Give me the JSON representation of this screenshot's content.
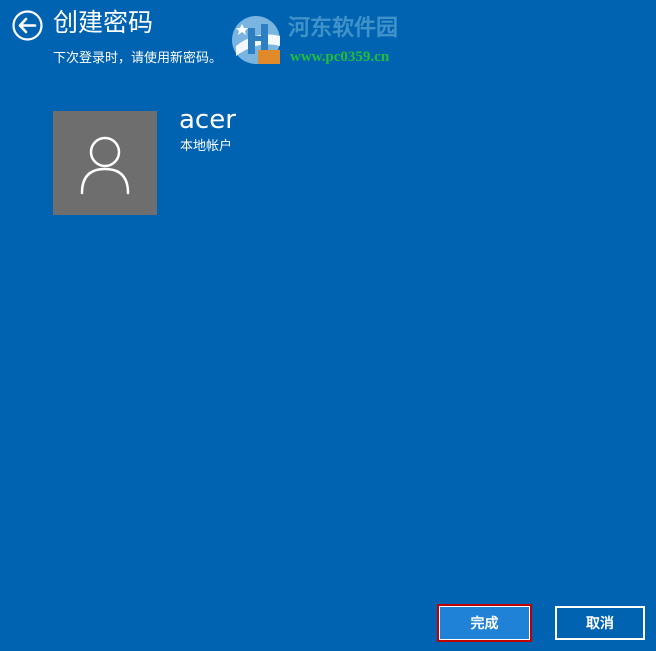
{
  "header": {
    "title": "创建密码",
    "subtitle": "下次登录时，请使用新密码。",
    "back_icon": "back-arrow-icon"
  },
  "watermark": {
    "name": "河东软件园",
    "url": "www.pc0359.cn"
  },
  "account": {
    "avatar_icon": "user-icon",
    "name": "acer",
    "type": "本地帐户"
  },
  "actions": {
    "finish_label": "完成",
    "cancel_label": "取消"
  },
  "colors": {
    "background": "#0063B1",
    "avatar_bg": "#6E6E6E",
    "finish_button_bg": "#1F82D6",
    "highlight_border": "#C00000",
    "watermark_name": "#3F93C9",
    "watermark_url": "#1FBF3A"
  }
}
